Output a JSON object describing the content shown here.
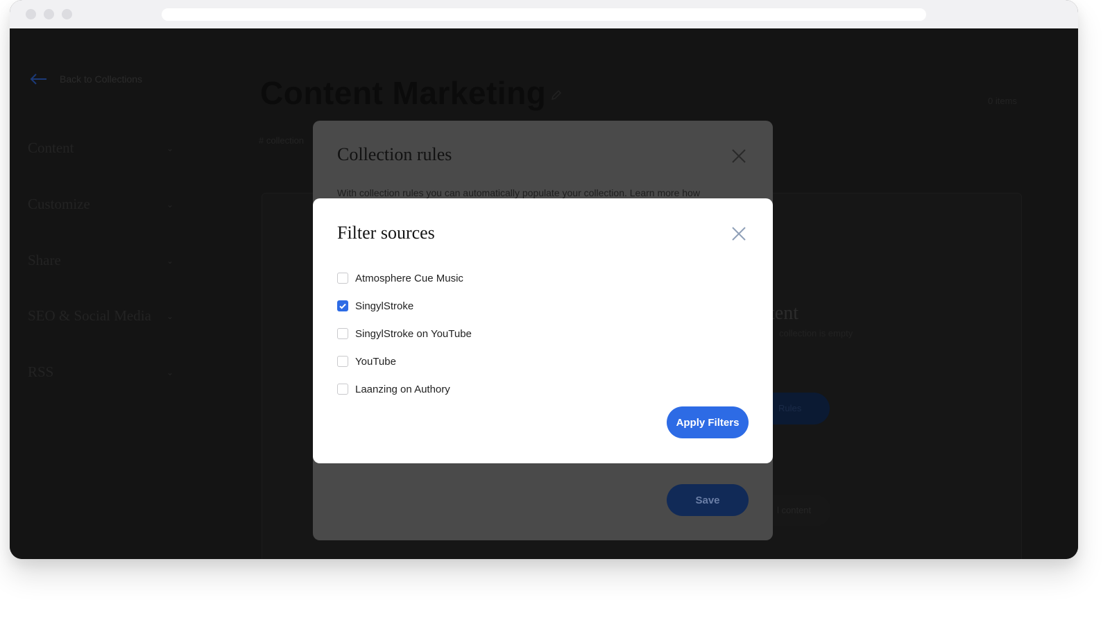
{
  "background": {
    "back_link": "Back to Collections",
    "page_title": "Content Marketing",
    "items_count": "0 items",
    "breadcrumb": "# collection",
    "sidebar": [
      "Content",
      "Customize",
      "Share",
      "SEO & Social Media",
      "RSS"
    ],
    "empty_heading_fragment": "tent",
    "empty_sub_fragment": "collection is empty",
    "rules_button_fragment": "Rules",
    "add_content_fragment": "l content"
  },
  "collection_rules_modal": {
    "title": "Collection rules",
    "description": "With collection rules you can automatically populate your collection. Learn more how",
    "save_label": "Save"
  },
  "filter_modal": {
    "title": "Filter sources",
    "options": [
      {
        "label": "Atmosphere Cue Music",
        "checked": false
      },
      {
        "label": "SingylStroke",
        "checked": true
      },
      {
        "label": "SingylStroke on YouTube",
        "checked": false
      },
      {
        "label": "YouTube",
        "checked": false
      },
      {
        "label": "Laanzing on Authory",
        "checked": false
      }
    ],
    "apply_label": "Apply Filters"
  },
  "colors": {
    "accent": "#2d6be5",
    "overlay": "#151515",
    "modal_back": "#4a4a4a"
  }
}
